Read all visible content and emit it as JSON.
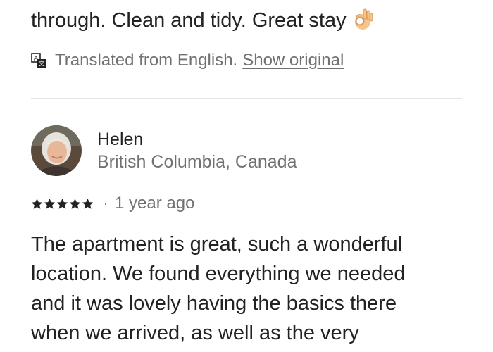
{
  "previous_review": {
    "partial_line": "",
    "last_line": "through. Clean and tidy. Great stay",
    "emoji": "ok-hand-emoji"
  },
  "translation": {
    "note": "Translated from English.",
    "show_original_label": "Show original",
    "icon": "translate-icon"
  },
  "review": {
    "reviewer_name": "Helen",
    "reviewer_location": "British Columbia, Canada",
    "avatar": "avatar",
    "rating": 5,
    "rating_max": 5,
    "separator": "·",
    "time_ago": "1 year ago",
    "body_lines": [
      "The apartment is great, such a wonderful",
      "location. We found everything we needed",
      "and it was lovely having the basics there",
      "when we arrived, as well as the very"
    ]
  },
  "colors": {
    "text_primary": "#222222",
    "text_secondary": "#717171",
    "divider": "#e4e4e4",
    "star": "#222222"
  }
}
